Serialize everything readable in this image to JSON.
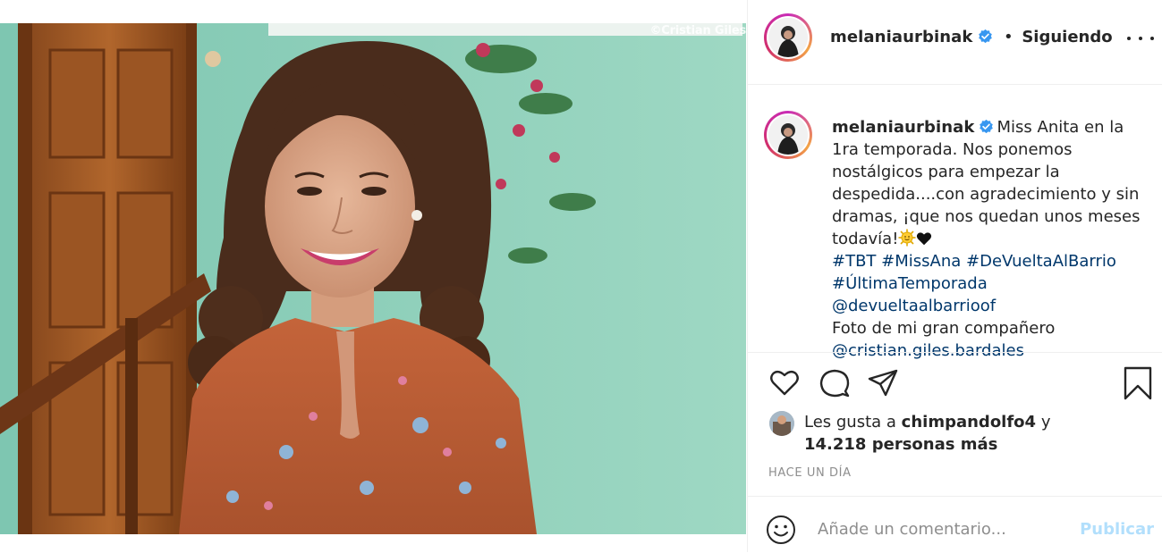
{
  "post": {
    "photo_alt": "",
    "watermark": "©Cristian Giles"
  },
  "header": {
    "username": "melaniaurbinak",
    "separator": "•",
    "follow_status": "Siguiendo",
    "more_icon": "more-options-icon"
  },
  "caption": {
    "username": "melaniaurbinak",
    "text": "Miss Anita en la 1ra temporada. Nos ponemos nostálgicos para empezar la despedida....con agradecimiento y sin dramas, ¡que nos quedan unos meses todavía!",
    "hashtags": [
      "#TBT",
      "#MissAna",
      "#DeVueltaAlBarrio",
      "#ÚltimaTemporada"
    ],
    "mention_1": "@devueltaalbarrioof",
    "photo_credit": "Foto de mi gran compañero",
    "mention_2": "@cristian.giles.bardales"
  },
  "actions": {
    "like_icon": "heart-icon",
    "comment_icon": "comment-icon",
    "share_icon": "send-icon",
    "save_icon": "bookmark-icon"
  },
  "likes": {
    "prefix": "Les gusta a",
    "user": "chimpandolfo4",
    "connector": "y",
    "count": "14.218 personas más"
  },
  "timestamp": "HACE UN DÍA",
  "comment": {
    "placeholder": "Añade un comentario...",
    "publish_label": "Publicar"
  },
  "colors": {
    "link": "#00376b",
    "verified": "#3897f0",
    "publish_disabled": "#b2dffc",
    "muted": "#8e8e8e"
  }
}
